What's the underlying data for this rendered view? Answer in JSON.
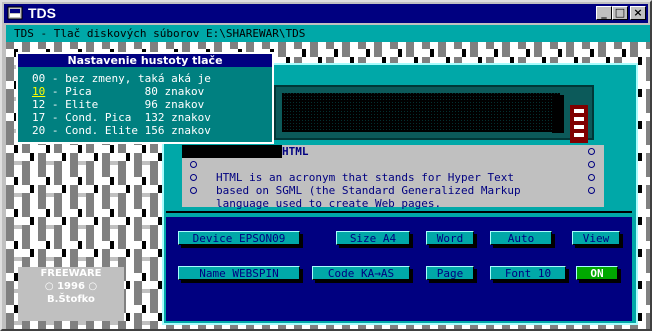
{
  "window": {
    "title": "TDS",
    "controls": {
      "minimize": "_",
      "maximize": "□",
      "close": "×"
    }
  },
  "headline": "TDS - Tlač diskových súborov E:\\SHAREWAR\\TDS",
  "density_menu": {
    "title": "Nastavenie hustoty tlače",
    "rows": [
      {
        "code": "00",
        "text": " - bez zmeny, taká aká je"
      },
      {
        "code": "10",
        "text": " - Pica        80 znakov"
      },
      {
        "code": "12",
        "text": " - Elite       96 znakov"
      },
      {
        "code": "17",
        "text": " - Cond. Pica  132 znakov"
      },
      {
        "code": "20",
        "text": " - Cond. Elite 156 znakov"
      }
    ],
    "selected_index": 1
  },
  "text_preview": {
    "heading": "HTML",
    "lines": [
      "",
      "HTML is an acronym that stands for Hyper Text",
      "based on SGML (the Standard Generalized Markup",
      "language used to create Web pages."
    ]
  },
  "buttons_row1": {
    "device": "Device EPSON09",
    "size": "Size A4",
    "word": "Word",
    "auto": "Auto",
    "view": "View"
  },
  "buttons_row2": {
    "name": "Name WEBSPIN",
    "code": "Code KA→AS",
    "page": "Page",
    "font": "Font 10",
    "on": "ON"
  },
  "freeware": {
    "line1": "FREEWARE",
    "line2": "○  1996  ○",
    "line3": "B.Štofko"
  },
  "colors": {
    "title_bar": "#000080",
    "panel": "#00a8a8",
    "menu_bg": "#008080",
    "on_button": "#00a800"
  }
}
